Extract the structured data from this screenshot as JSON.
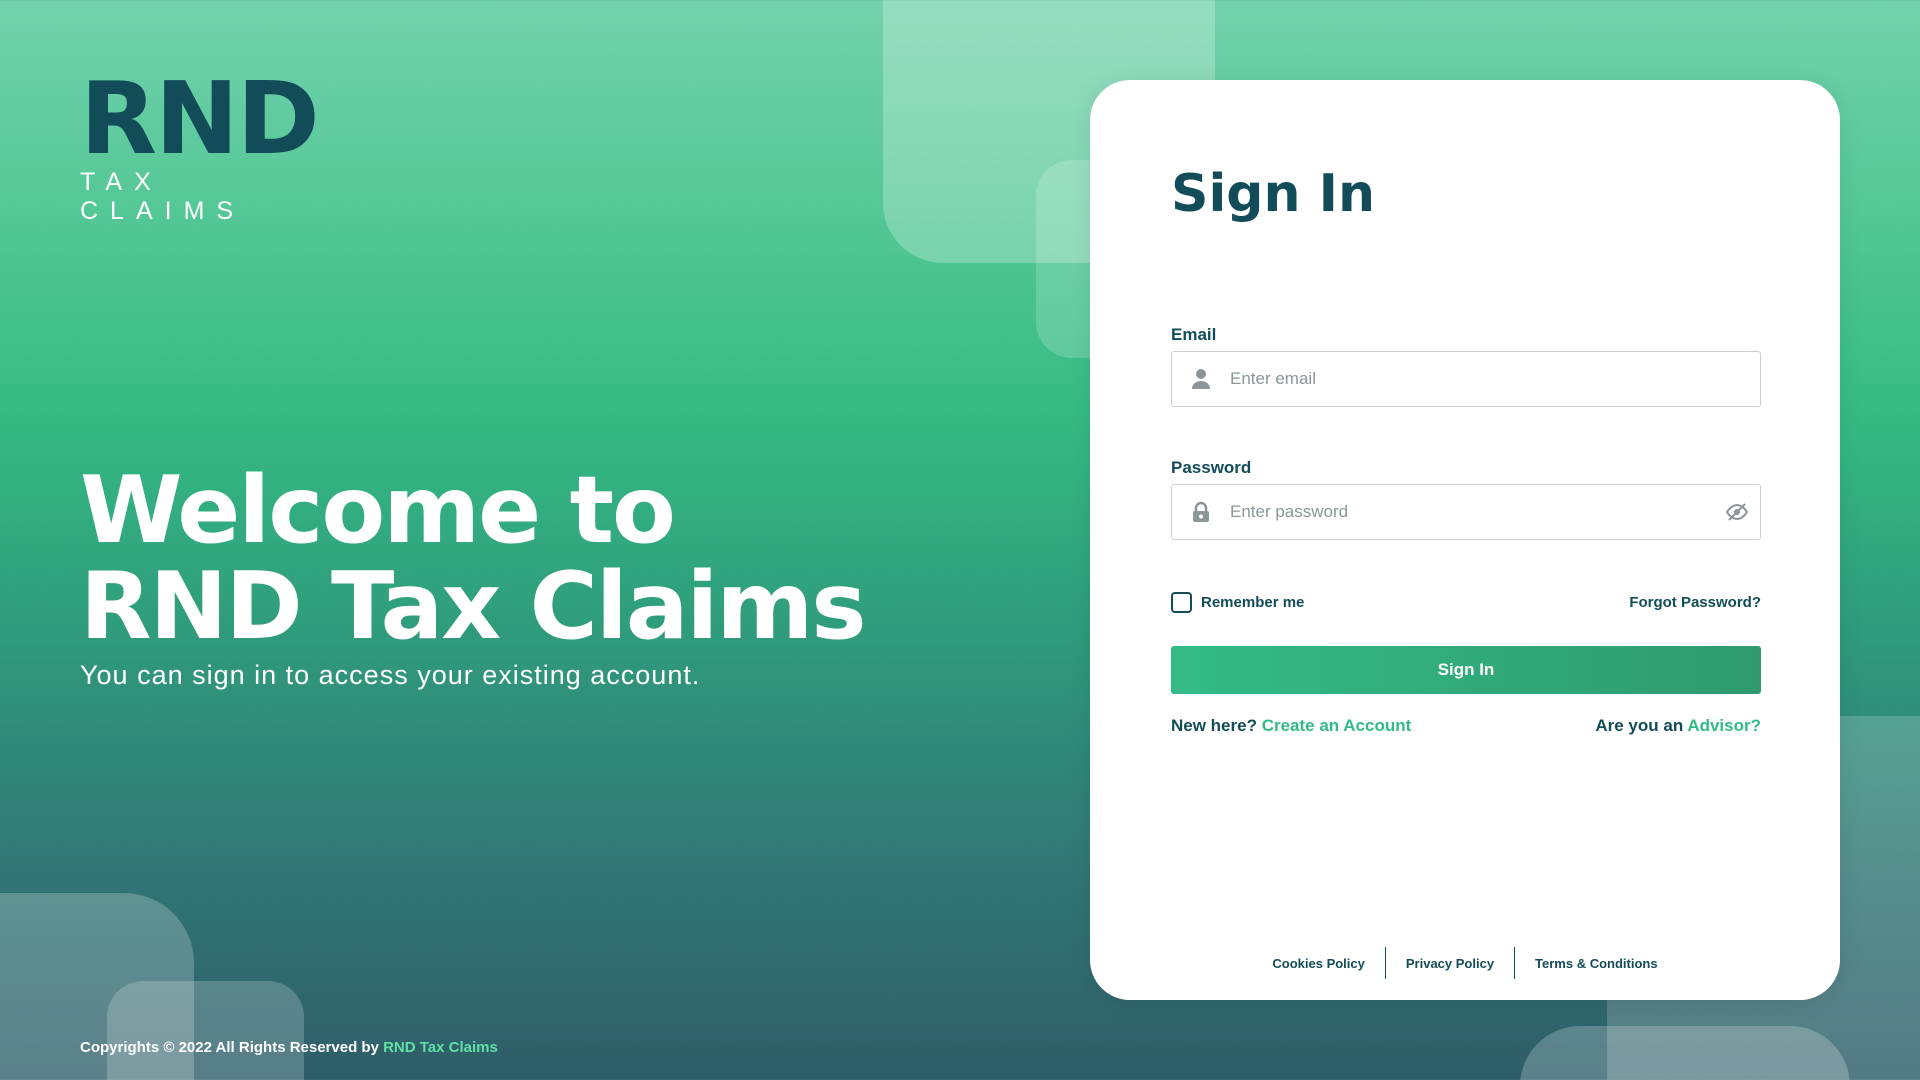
{
  "brand": {
    "logo_mark": "RND",
    "logo_sub": "TAX CLAIMS"
  },
  "hero": {
    "line1": "Welcome to",
    "line2": "RND Tax Claims",
    "subtitle": "You can sign in to access your existing account."
  },
  "copyright": {
    "text": "Copyrights © 2022 All Rights Reserved by ",
    "brand": "RND Tax Claims"
  },
  "form": {
    "title": "Sign In",
    "email_label": "Email",
    "email_placeholder": "Enter email",
    "password_label": "Password",
    "password_placeholder": "Enter password",
    "remember_label": "Remember me",
    "remember_checked": false,
    "forgot_label": "Forgot Password?",
    "submit_label": "Sign In",
    "new_here": "New here? ",
    "create_account": "Create an Account",
    "advisor_prefix": "Are you an ",
    "advisor_link": "Advisor?"
  },
  "footer": {
    "cookies": "Cookies Policy",
    "privacy": "Privacy Policy",
    "terms": "Terms & Conditions"
  },
  "colors": {
    "primary_dark": "#134c59",
    "accent_green": "#33bb86",
    "link_green": "#5ee0a4"
  },
  "icons": [
    "user-icon",
    "lock-icon",
    "eye-slash-icon"
  ]
}
